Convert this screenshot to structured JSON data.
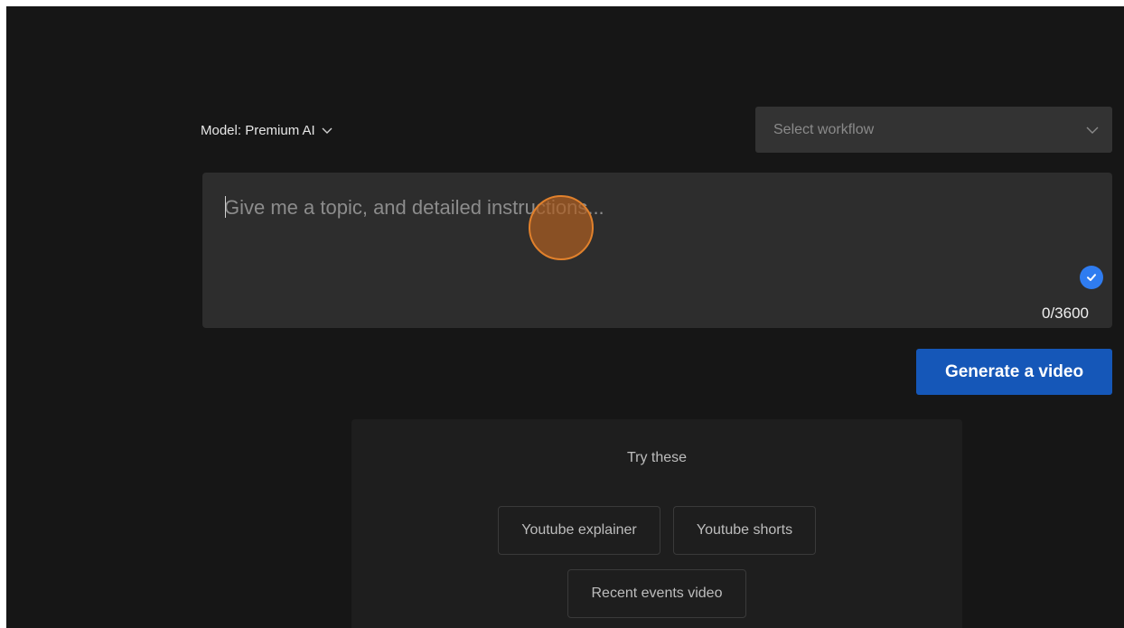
{
  "header": {
    "model_prefix": "Model:",
    "model_value": "Premium AI",
    "workflow_placeholder": "Select workflow"
  },
  "prompt": {
    "placeholder": "Give me a topic, and detailed instructions...",
    "value": "",
    "char_count": "0/3600"
  },
  "actions": {
    "generate_label": "Generate a video"
  },
  "suggestions": {
    "title": "Try these",
    "items": [
      {
        "label": "Youtube explainer"
      },
      {
        "label": "Youtube shorts"
      },
      {
        "label": "Recent events video"
      }
    ]
  },
  "colors": {
    "background": "#161616",
    "surface": "#2d2d2d",
    "accent": "#1557b8",
    "check": "#2f7cf0",
    "cursor_highlight": "#e1812c"
  },
  "icons": {
    "model_dropdown": "chevron-down-icon",
    "workflow_dropdown": "chevron-down-icon",
    "check": "check-circle-icon"
  }
}
